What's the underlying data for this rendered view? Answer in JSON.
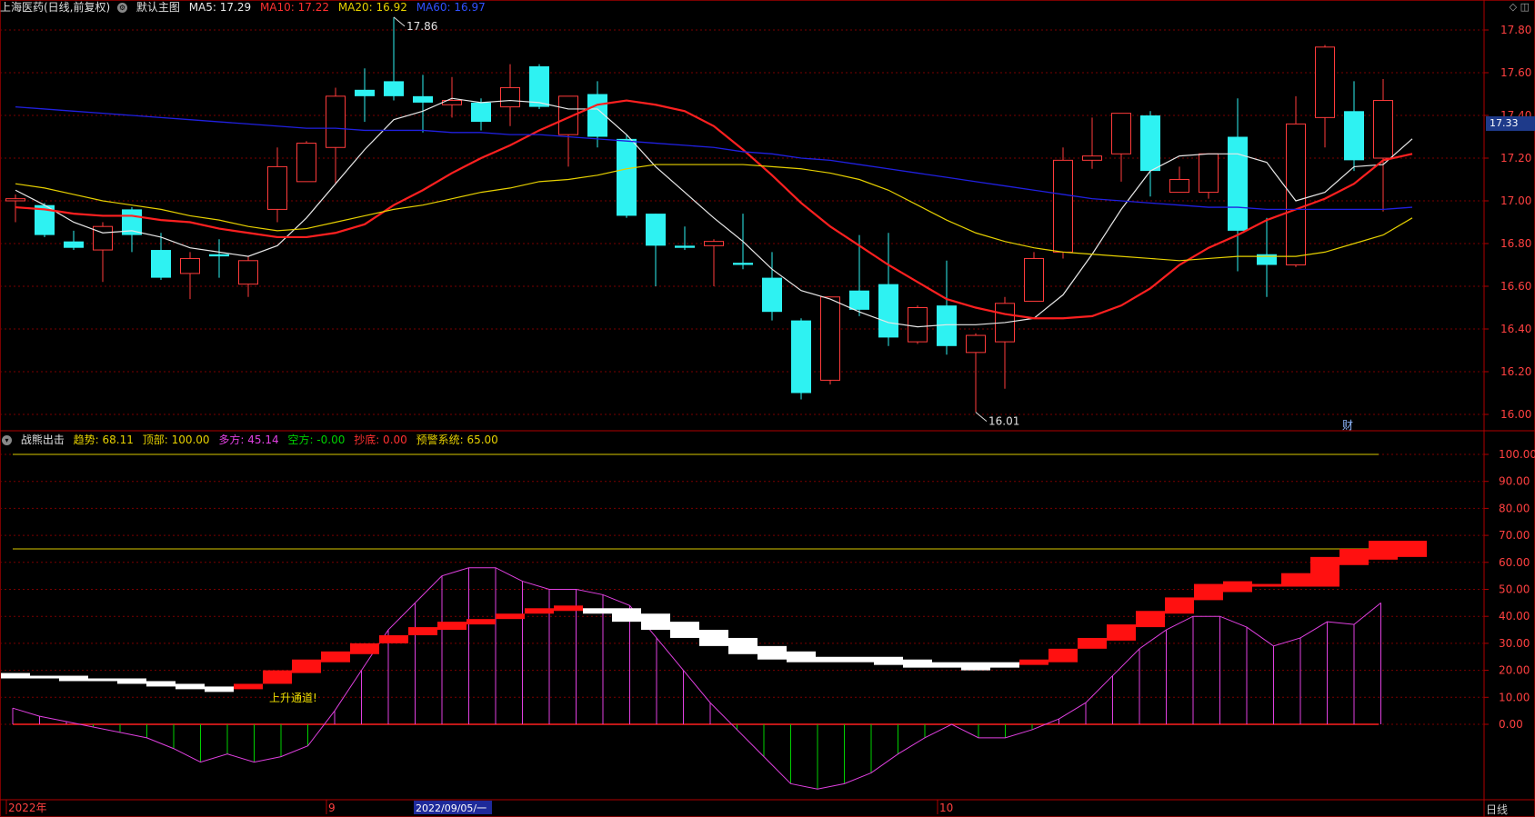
{
  "main_header": {
    "stock": "上海医药(日线,前复权)",
    "overlay": "默认主图",
    "ma5": "MA5: 17.29",
    "ma10": "MA10: 17.22",
    "ma20": "MA20: 16.92",
    "ma60": "MA60: 16.97"
  },
  "sub_header": {
    "name": "战熊出击",
    "trend": "趋势: 68.11",
    "top": "顶部: 100.00",
    "bull": "多方: 45.14",
    "bear": "空方: -0.00",
    "bottom": "抄底: 0.00",
    "warn": "预警系统: 65.00"
  },
  "current_price_label": "17.33",
  "period_label": "日线",
  "top_icons": "◇ ◫",
  "colors": {
    "up": "#ff3b3b",
    "down": "#2ef2f2",
    "ma5": "#e8e8e8",
    "ma10": "#ff2020",
    "ma20": "#e6d000",
    "ma60": "#2020e0",
    "grid": "#7a0000",
    "magenta": "#e040e0",
    "green": "#00d000"
  },
  "chart_data": [
    {
      "type": "candlestick",
      "title": "上海医药(日线,前复权)",
      "ylim": [
        15.95,
        17.9
      ],
      "y_ticks": [
        "17.80",
        "17.60",
        "17.40",
        "17.20",
        "17.00",
        "16.80",
        "16.60",
        "16.40",
        "16.20",
        "16.00"
      ],
      "annotations": [
        {
          "label": "17.86",
          "index": 13,
          "value": 17.86
        },
        {
          "label": "16.01",
          "index": 33,
          "value": 16.01
        }
      ],
      "event_marker": "财",
      "candles": [
        {
          "o": 17.0,
          "h": 17.03,
          "l": 16.9,
          "c": 17.01
        },
        {
          "o": 16.98,
          "h": 16.99,
          "l": 16.83,
          "c": 16.84
        },
        {
          "o": 16.81,
          "h": 16.86,
          "l": 16.77,
          "c": 16.78
        },
        {
          "o": 16.77,
          "h": 16.9,
          "l": 16.62,
          "c": 16.88
        },
        {
          "o": 16.96,
          "h": 16.97,
          "l": 16.76,
          "c": 16.84
        },
        {
          "o": 16.77,
          "h": 16.85,
          "l": 16.63,
          "c": 16.64
        },
        {
          "o": 16.66,
          "h": 16.76,
          "l": 16.54,
          "c": 16.73
        },
        {
          "o": 16.75,
          "h": 16.82,
          "l": 16.64,
          "c": 16.74
        },
        {
          "o": 16.61,
          "h": 16.74,
          "l": 16.55,
          "c": 16.72
        },
        {
          "o": 16.96,
          "h": 17.25,
          "l": 16.9,
          "c": 17.16
        },
        {
          "o": 17.09,
          "h": 17.28,
          "l": 17.09,
          "c": 17.27
        },
        {
          "o": 17.25,
          "h": 17.53,
          "l": 17.08,
          "c": 17.49
        },
        {
          "o": 17.52,
          "h": 17.62,
          "l": 17.37,
          "c": 17.49
        },
        {
          "o": 17.56,
          "h": 17.86,
          "l": 17.47,
          "c": 17.49
        },
        {
          "o": 17.49,
          "h": 17.59,
          "l": 17.32,
          "c": 17.46
        },
        {
          "o": 17.45,
          "h": 17.58,
          "l": 17.39,
          "c": 17.47
        },
        {
          "o": 17.46,
          "h": 17.48,
          "l": 17.33,
          "c": 17.37
        },
        {
          "o": 17.44,
          "h": 17.64,
          "l": 17.35,
          "c": 17.53
        },
        {
          "o": 17.63,
          "h": 17.64,
          "l": 17.43,
          "c": 17.44
        },
        {
          "o": 17.31,
          "h": 17.49,
          "l": 17.16,
          "c": 17.49
        },
        {
          "o": 17.5,
          "h": 17.56,
          "l": 17.25,
          "c": 17.3
        },
        {
          "o": 17.29,
          "h": 17.31,
          "l": 16.92,
          "c": 16.93
        },
        {
          "o": 16.94,
          "h": 16.94,
          "l": 16.6,
          "c": 16.79
        },
        {
          "o": 16.79,
          "h": 16.88,
          "l": 16.77,
          "c": 16.78
        },
        {
          "o": 16.79,
          "h": 16.82,
          "l": 16.6,
          "c": 16.81
        },
        {
          "o": 16.71,
          "h": 16.94,
          "l": 16.68,
          "c": 16.7
        },
        {
          "o": 16.64,
          "h": 16.76,
          "l": 16.44,
          "c": 16.48
        },
        {
          "o": 16.44,
          "h": 16.45,
          "l": 16.07,
          "c": 16.1
        },
        {
          "o": 16.16,
          "h": 16.55,
          "l": 16.14,
          "c": 16.55
        },
        {
          "o": 16.58,
          "h": 16.84,
          "l": 16.46,
          "c": 16.49
        },
        {
          "o": 16.61,
          "h": 16.85,
          "l": 16.32,
          "c": 16.36
        },
        {
          "o": 16.34,
          "h": 16.51,
          "l": 16.33,
          "c": 16.5
        },
        {
          "o": 16.51,
          "h": 16.72,
          "l": 16.28,
          "c": 16.32
        },
        {
          "o": 16.29,
          "h": 16.38,
          "l": 16.01,
          "c": 16.37
        },
        {
          "o": 16.34,
          "h": 16.55,
          "l": 16.12,
          "c": 16.52
        },
        {
          "o": 16.53,
          "h": 16.76,
          "l": 16.53,
          "c": 16.73
        },
        {
          "o": 16.76,
          "h": 17.25,
          "l": 16.73,
          "c": 17.19
        },
        {
          "o": 17.19,
          "h": 17.39,
          "l": 17.15,
          "c": 17.21
        },
        {
          "o": 17.22,
          "h": 17.41,
          "l": 17.09,
          "c": 17.41
        },
        {
          "o": 17.4,
          "h": 17.42,
          "l": 17.02,
          "c": 17.14
        },
        {
          "o": 17.04,
          "h": 17.16,
          "l": 17.04,
          "c": 17.1
        },
        {
          "o": 17.04,
          "h": 17.22,
          "l": 17.01,
          "c": 17.22
        },
        {
          "o": 17.3,
          "h": 17.48,
          "l": 16.67,
          "c": 16.86
        },
        {
          "o": 16.75,
          "h": 16.92,
          "l": 16.55,
          "c": 16.7
        },
        {
          "o": 16.7,
          "h": 17.49,
          "l": 16.69,
          "c": 17.36
        },
        {
          "o": 17.39,
          "h": 17.73,
          "l": 17.25,
          "c": 17.72
        },
        {
          "o": 17.42,
          "h": 17.56,
          "l": 17.14,
          "c": 17.19
        },
        {
          "o": 17.2,
          "h": 17.57,
          "l": 16.95,
          "c": 17.47
        }
      ],
      "series": [
        {
          "name": "MA5",
          "values": [
            17.05,
            16.98,
            16.9,
            16.85,
            16.86,
            16.83,
            16.78,
            16.76,
            16.74,
            16.79,
            16.92,
            17.08,
            17.24,
            17.38,
            17.42,
            17.48,
            17.46,
            17.47,
            17.46,
            17.43,
            17.43,
            17.31,
            17.16,
            17.04,
            16.92,
            16.81,
            16.68,
            16.58,
            16.54,
            16.48,
            16.43,
            16.41,
            16.42,
            16.42,
            16.43,
            16.45,
            16.56,
            16.75,
            16.96,
            17.14,
            17.21,
            17.22,
            17.22,
            17.18,
            17.0,
            17.04,
            17.16,
            17.17,
            17.29
          ]
        },
        {
          "name": "MA10",
          "values": [
            16.97,
            16.96,
            16.94,
            16.93,
            16.93,
            16.91,
            16.9,
            16.87,
            16.85,
            16.83,
            16.83,
            16.85,
            16.89,
            16.98,
            17.05,
            17.13,
            17.2,
            17.26,
            17.33,
            17.39,
            17.45,
            17.47,
            17.45,
            17.42,
            17.35,
            17.24,
            17.12,
            16.99,
            16.88,
            16.79,
            16.7,
            16.62,
            16.54,
            16.5,
            16.47,
            16.45,
            16.45,
            16.46,
            16.51,
            16.59,
            16.7,
            16.78,
            16.84,
            16.91,
            16.96,
            17.01,
            17.08,
            17.19,
            17.22
          ]
        },
        {
          "name": "MA20",
          "values": [
            17.08,
            17.06,
            17.03,
            17.0,
            16.98,
            16.96,
            16.93,
            16.91,
            16.88,
            16.86,
            16.87,
            16.9,
            16.93,
            16.96,
            16.98,
            17.01,
            17.04,
            17.06,
            17.09,
            17.1,
            17.12,
            17.15,
            17.17,
            17.17,
            17.17,
            17.17,
            17.16,
            17.15,
            17.13,
            17.1,
            17.05,
            16.98,
            16.91,
            16.85,
            16.81,
            16.78,
            16.76,
            16.75,
            16.74,
            16.73,
            16.72,
            16.73,
            16.74,
            16.74,
            16.74,
            16.76,
            16.8,
            16.84,
            16.92
          ]
        },
        {
          "name": "MA60",
          "values": [
            17.44,
            17.43,
            17.42,
            17.41,
            17.4,
            17.39,
            17.38,
            17.37,
            17.36,
            17.35,
            17.34,
            17.34,
            17.33,
            17.33,
            17.33,
            17.32,
            17.32,
            17.31,
            17.31,
            17.3,
            17.29,
            17.28,
            17.27,
            17.26,
            17.25,
            17.23,
            17.22,
            17.2,
            17.19,
            17.17,
            17.15,
            17.13,
            17.11,
            17.09,
            17.07,
            17.05,
            17.03,
            17.01,
            17.0,
            16.99,
            16.98,
            16.97,
            16.97,
            16.96,
            16.96,
            16.96,
            16.96,
            16.96,
            16.97
          ]
        }
      ]
    },
    {
      "type": "indicator",
      "title": "战熊出击",
      "ylim": [
        -25,
        105
      ],
      "y_ticks": [
        "100.00",
        "90.00",
        "80.00",
        "70.00",
        "60.00",
        "50.00",
        "40.00",
        "30.00",
        "20.00",
        "10.00",
        "0.00"
      ],
      "reference_lines": [
        {
          "name": "顶部",
          "value": 100
        },
        {
          "name": "预警系统",
          "value": 65
        }
      ],
      "annotation": {
        "label": "上升通道!",
        "index": 9
      },
      "trend_blocks": [
        {
          "lo": 17,
          "hi": 19,
          "color": "white"
        },
        {
          "lo": 17,
          "hi": 18,
          "color": "white"
        },
        {
          "lo": 16,
          "hi": 18,
          "color": "white"
        },
        {
          "lo": 16,
          "hi": 17,
          "color": "white"
        },
        {
          "lo": 15,
          "hi": 17,
          "color": "white"
        },
        {
          "lo": 14,
          "hi": 16,
          "color": "white"
        },
        {
          "lo": 13,
          "hi": 15,
          "color": "white"
        },
        {
          "lo": 12,
          "hi": 14,
          "color": "white"
        },
        {
          "lo": 13,
          "hi": 15,
          "color": "red"
        },
        {
          "lo": 15,
          "hi": 20,
          "color": "red"
        },
        {
          "lo": 19,
          "hi": 24,
          "color": "red"
        },
        {
          "lo": 23,
          "hi": 27,
          "color": "red"
        },
        {
          "lo": 26,
          "hi": 30,
          "color": "red"
        },
        {
          "lo": 30,
          "hi": 33,
          "color": "red"
        },
        {
          "lo": 33,
          "hi": 36,
          "color": "red"
        },
        {
          "lo": 35,
          "hi": 38,
          "color": "red"
        },
        {
          "lo": 37,
          "hi": 39,
          "color": "red"
        },
        {
          "lo": 39,
          "hi": 41,
          "color": "red"
        },
        {
          "lo": 41,
          "hi": 43,
          "color": "red"
        },
        {
          "lo": 42,
          "hi": 44,
          "color": "red"
        },
        {
          "lo": 41,
          "hi": 43,
          "color": "white"
        },
        {
          "lo": 38,
          "hi": 43,
          "color": "white"
        },
        {
          "lo": 35,
          "hi": 41,
          "color": "white"
        },
        {
          "lo": 32,
          "hi": 38,
          "color": "white"
        },
        {
          "lo": 29,
          "hi": 35,
          "color": "white"
        },
        {
          "lo": 26,
          "hi": 32,
          "color": "white"
        },
        {
          "lo": 24,
          "hi": 29,
          "color": "white"
        },
        {
          "lo": 23,
          "hi": 27,
          "color": "white"
        },
        {
          "lo": 23,
          "hi": 25,
          "color": "white"
        },
        {
          "lo": 23,
          "hi": 25,
          "color": "white"
        },
        {
          "lo": 22,
          "hi": 25,
          "color": "white"
        },
        {
          "lo": 21,
          "hi": 24,
          "color": "white"
        },
        {
          "lo": 21,
          "hi": 23,
          "color": "white"
        },
        {
          "lo": 20,
          "hi": 23,
          "color": "white"
        },
        {
          "lo": 21,
          "hi": 23,
          "color": "white"
        },
        {
          "lo": 22,
          "hi": 24,
          "color": "red"
        },
        {
          "lo": 23,
          "hi": 28,
          "color": "red"
        },
        {
          "lo": 28,
          "hi": 32,
          "color": "red"
        },
        {
          "lo": 31,
          "hi": 37,
          "color": "red"
        },
        {
          "lo": 36,
          "hi": 42,
          "color": "red"
        },
        {
          "lo": 41,
          "hi": 47,
          "color": "red"
        },
        {
          "lo": 46,
          "hi": 52,
          "color": "red"
        },
        {
          "lo": 49,
          "hi": 53,
          "color": "red"
        },
        {
          "lo": 51,
          "hi": 52,
          "color": "red"
        },
        {
          "lo": 51,
          "hi": 56,
          "color": "red"
        },
        {
          "lo": 51,
          "hi": 62,
          "color": "red"
        },
        {
          "lo": 59,
          "hi": 65,
          "color": "red"
        },
        {
          "lo": 61,
          "hi": 68,
          "color": "red"
        },
        {
          "lo": 62,
          "hi": 68,
          "color": "red"
        }
      ],
      "osc_values": [
        6,
        3,
        1,
        -1,
        -3,
        -5,
        -9,
        -14,
        -11,
        -14,
        -12,
        -8,
        5,
        20,
        35,
        45,
        55,
        58,
        58,
        53,
        50,
        50,
        48,
        44,
        32,
        20,
        8,
        -2,
        -12,
        -22,
        -24,
        -22,
        -18,
        -11,
        -5,
        0,
        -5,
        -5,
        -2,
        2,
        8,
        18,
        28,
        35,
        40,
        40,
        36,
        29,
        32,
        38,
        37,
        45
      ]
    }
  ],
  "x_labels": [
    {
      "label": "2022年",
      "index": 0
    },
    {
      "label": "9",
      "index": 11
    },
    {
      "label": "2022/09/05/一",
      "index": 14
    },
    {
      "label": "10",
      "index": 32
    }
  ]
}
